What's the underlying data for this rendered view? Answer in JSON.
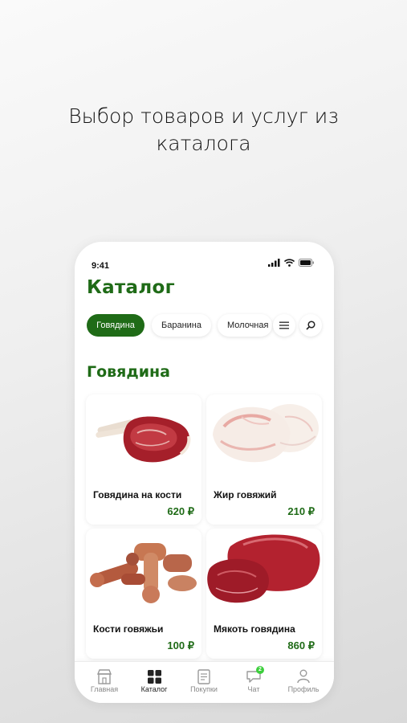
{
  "headline": {
    "line1": "Выбор товаров и услуг из",
    "line2": "каталога"
  },
  "status": {
    "time": "9:41"
  },
  "page": {
    "title": "Каталог"
  },
  "chips": [
    {
      "label": "Говядина",
      "active": true
    },
    {
      "label": "Баранина",
      "active": false
    },
    {
      "label": "Молочная",
      "active": false
    }
  ],
  "section": {
    "title": "Говядина"
  },
  "products": [
    {
      "name": "Говядина на кости",
      "price": "620 ₽"
    },
    {
      "name": "Жир говяжий",
      "price": "210 ₽"
    },
    {
      "name": "Кости говяжьи",
      "price": "100 ₽"
    },
    {
      "name": "Мякоть говядина",
      "price": "860 ₽"
    }
  ],
  "tabbar": {
    "items": [
      {
        "label": "Главная",
        "icon": "shop-icon"
      },
      {
        "label": "Каталог",
        "icon": "grid-icon"
      },
      {
        "label": "Покупки",
        "icon": "receipt-icon"
      },
      {
        "label": "Чат",
        "icon": "chat-icon",
        "badge": "2"
      },
      {
        "label": "Профиль",
        "icon": "user-icon"
      }
    ],
    "active": "Каталог"
  },
  "colors": {
    "accent": "#1f6b17",
    "badge": "#3ccf3c"
  }
}
